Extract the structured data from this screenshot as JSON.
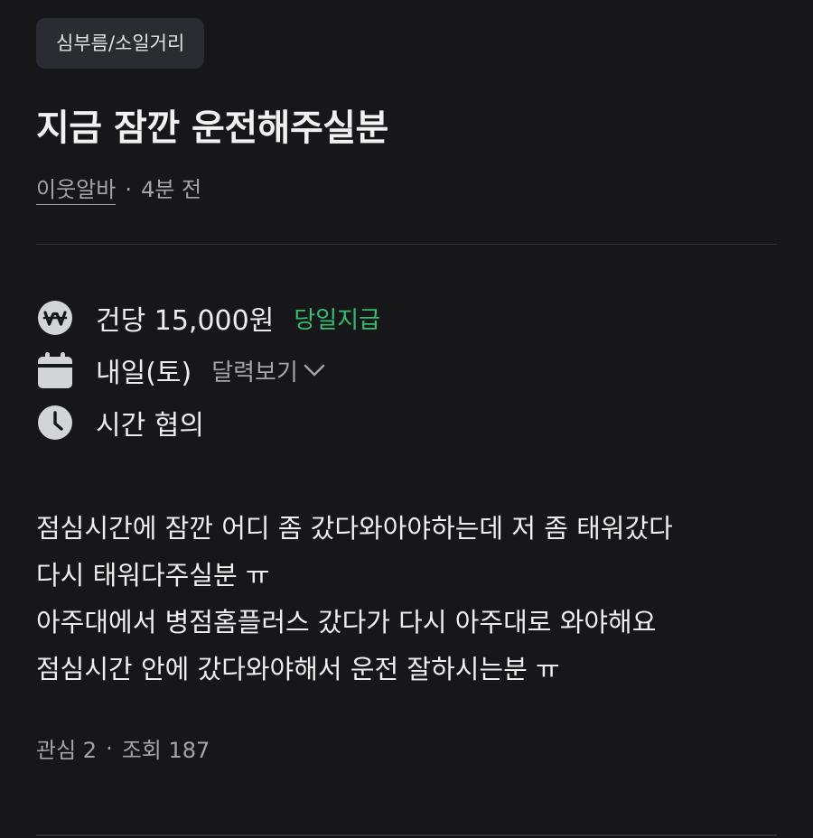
{
  "category": "심부름/소일거리",
  "title": "지금 잠깐 운전해주실분",
  "author": "이웃알바",
  "meta_separator": "·",
  "time_ago": "4분 전",
  "pay": {
    "icon": "won-icon",
    "amount": "건당 15,000원",
    "badge": "당일지급",
    "badge_color": "#2fbf71"
  },
  "date": {
    "icon": "calendar-icon",
    "value": "내일(토)",
    "calendar_link": "달력보기"
  },
  "time": {
    "icon": "clock-icon",
    "value": "시간 협의"
  },
  "description_lines": [
    "점심시간에 잠깐 어디 좀 갔다와아야하는데 저 좀 태워갔다",
    "다시 태워다주실분 ㅠ",
    "아주대에서 병점홈플러스 갔다가 다시 아주대로 와야해요",
    "점심시간 안에 갔다와야해서 운전 잘하시는분 ㅠ"
  ],
  "stats": {
    "interest": "관심 2",
    "separator": "·",
    "views": "조회 187"
  },
  "colors": {
    "background": "#17171a",
    "chip_background": "#2b2c31",
    "muted_text": "#a4a5ab",
    "icon_fill": "#d3d4d7"
  }
}
